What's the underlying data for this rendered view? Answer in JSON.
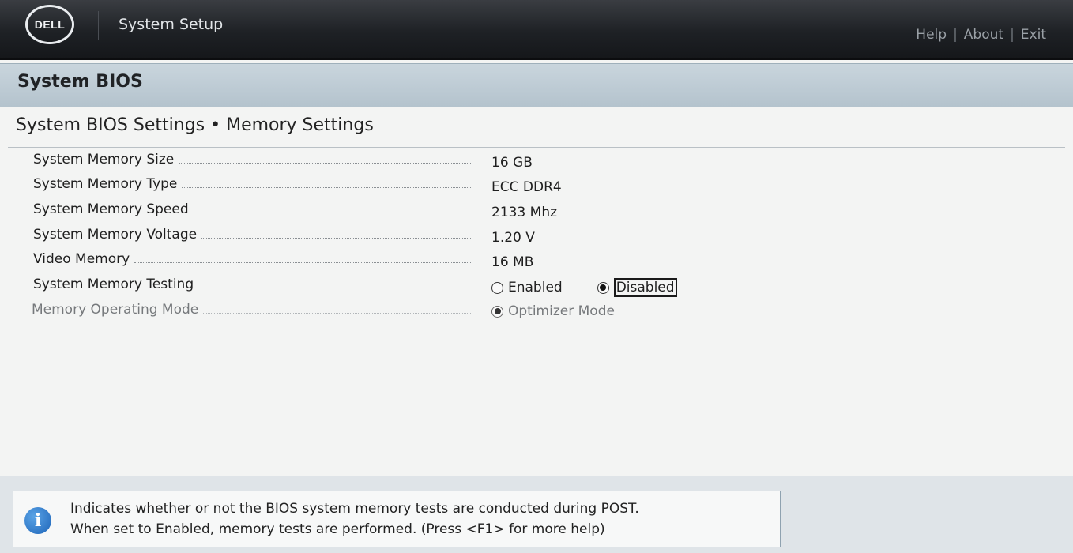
{
  "header": {
    "logo_text": "DELL",
    "app_title": "System Setup",
    "links": [
      "Help",
      "About",
      "Exit"
    ],
    "separator": "|"
  },
  "section": {
    "title": "System BIOS"
  },
  "page": {
    "breadcrumb": "System BIOS Settings • Memory Settings"
  },
  "settings": [
    {
      "label": "System Memory Size",
      "value": "16 GB"
    },
    {
      "label": "System Memory Type",
      "value": "ECC DDR4"
    },
    {
      "label": "System Memory Speed",
      "value": "2133 Mhz"
    },
    {
      "label": "System Memory Voltage",
      "value": "1.20 V"
    },
    {
      "label": "Video Memory",
      "value": "16 MB"
    },
    {
      "label": "System Memory Testing",
      "options": [
        "Enabled",
        "Disabled"
      ],
      "selected": "Disabled"
    },
    {
      "label": "Memory Operating Mode",
      "options": [
        "Optimizer Mode"
      ],
      "selected": "Optimizer Mode",
      "disabled": true
    }
  ],
  "help": {
    "line1": "Indicates whether or not the BIOS system memory tests are conducted during POST.",
    "line2": "When set to Enabled, memory tests are performed. (Press <F1> for more help)"
  },
  "icons": {
    "info": "info-icon",
    "radio": "radio-icon"
  },
  "colors": {
    "header_bg": "#1e2125",
    "band_bg": "#b4c3cd",
    "info_blue": "#1d64b8"
  }
}
